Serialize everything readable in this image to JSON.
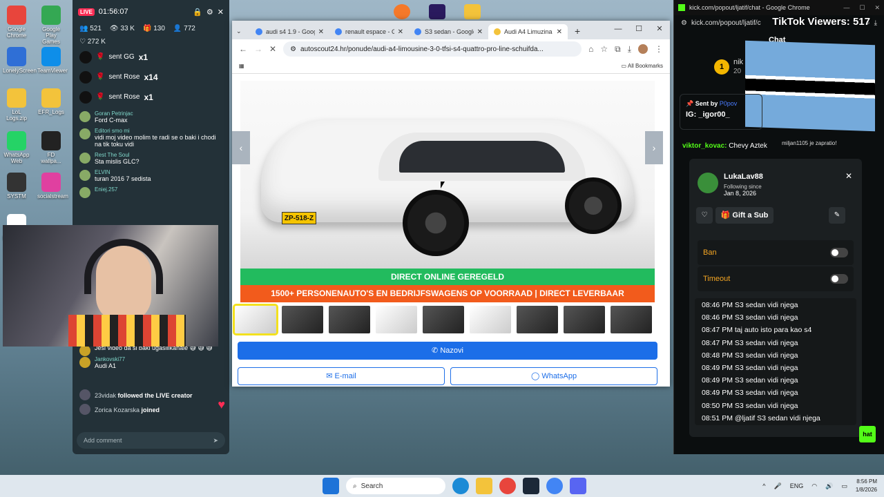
{
  "desktop": {
    "icons": [
      {
        "label": "Google Chrome",
        "color": "#e8453c"
      },
      {
        "label": "Google Play Games",
        "color": "#34a853"
      },
      {
        "label": "LonelyScreen",
        "color": "#2f6fd6"
      },
      {
        "label": "TeamViewer",
        "color": "#0e8ee9"
      },
      {
        "label": "LoL Logs.zip",
        "color": "#f3c33b"
      },
      {
        "label": "EFR_Logs",
        "color": "#f3c33b"
      },
      {
        "label": "WhatsApp Web",
        "color": "#25d366"
      },
      {
        "label": "FD wallpa...",
        "color": "#222222"
      },
      {
        "label": "SYSTM",
        "color": "#333333"
      },
      {
        "label": "socialstream",
        "color": "#e040a0"
      },
      {
        "label": "baner_FIN...",
        "color": "#ffffff"
      }
    ]
  },
  "tiktok": {
    "live_label": "LIVE",
    "timer": "01:56:07",
    "stats": {
      "viewers": "521",
      "views": "33 K",
      "gifts": "130",
      "followers": "772",
      "likes": "272 K"
    },
    "gifts": [
      {
        "text": "sent GG",
        "count": "x1"
      },
      {
        "text": "sent Rose",
        "count": "x14"
      },
      {
        "text": "sent Rose",
        "count": "x1"
      }
    ],
    "messages": [
      {
        "name": "Goran Petrinjac",
        "text": "Ford C-max"
      },
      {
        "name": "Editori smo mi",
        "text": "vidi moj video molim te radi se o baki i chodi na tik toku vidi"
      },
      {
        "name": "Rest The Soul",
        "text": "Sta mislis GLC?"
      },
      {
        "name": "ELVIN",
        "text": "turan 2016 7 sedista"
      },
      {
        "name": "Eniej.257",
        "text": ""
      }
    ],
    "bottom_messages": [
      {
        "name": "",
        "text": "Jesi video da si baki ugasilikanale 😅 😅 😅"
      },
      {
        "name": "Jankovski77",
        "text": "Audi A1"
      }
    ],
    "events": [
      {
        "user": "23vidak",
        "text": "followed the LIVE creator"
      },
      {
        "user": "Zorica Kozarska",
        "text": "joined"
      }
    ],
    "comment_placeholder": "Add comment"
  },
  "chrome": {
    "tabs": [
      {
        "label": "audi s4 1.9 - Google"
      },
      {
        "label": "renault espace - Go"
      },
      {
        "label": "S3 sedan - Google"
      },
      {
        "label": "Audi A4 Limuzina"
      }
    ],
    "url": "autoscout24.hr/ponude/audi-a4-limousine-3-0-tfsi-s4-quattro-pro-line-schuifda...",
    "bookmarks_label": "All Bookmarks",
    "plate": "ZP-518-Z",
    "banner_green": "DIRECT ONLINE GEREGELD",
    "banner_orange": "1500+ PERSONENAUTO'S EN BEDRIJFSWAGENS OP VOORRAAD | DIRECT LEVERBAAR",
    "btn_call": "Nazovi",
    "btn_email": "E-mail",
    "btn_whatsapp": "WhatsApp"
  },
  "kick": {
    "window_title": "kick.com/popout/ljatif/chat - Google Chrome",
    "url": "kick.com/popout/ljatif/c",
    "viewers_overlay": "TikTok Viewers: 517",
    "chat_label": "Chat",
    "user_top": "nik",
    "user_top_num": "20",
    "pinned": {
      "sent_by": "Sent by",
      "sender": "P0pov",
      "text": "IG: _igor00_"
    },
    "chat_line": {
      "user": "viktor_kovac:",
      "text": "Chevy Aztek"
    },
    "joined": "miljan1105 je zapratio!",
    "card": {
      "username": "LukaLav88",
      "following_since": "Following since",
      "date": "Jan 8, 2026",
      "gift_sub": "Gift a Sub",
      "ban": "Ban",
      "timeout": "Timeout",
      "log": [
        "08:46 PM S3 sedan vidi njega",
        "08:46 PM S3 sedan vidi njega",
        "08:47 PM taj auto isto para kao s4",
        "08:47 PM S3 sedan vidi njega",
        "08:48 PM S3 sedan vidi njega",
        "08:49 PM S3 sedan vidi njega",
        "08:49 PM S3 sedan vidi njega",
        "08:49 PM S3 sedan vidi njega",
        "08:50 PM S3 sedan vidi njega",
        "08:51 PM @ljatif S3 sedan vidi njega"
      ]
    },
    "chat_button": "hat"
  },
  "taskbar": {
    "search_placeholder": "Search",
    "lang": "ENG",
    "time": "8:56 PM",
    "date": "1/8/2026"
  }
}
